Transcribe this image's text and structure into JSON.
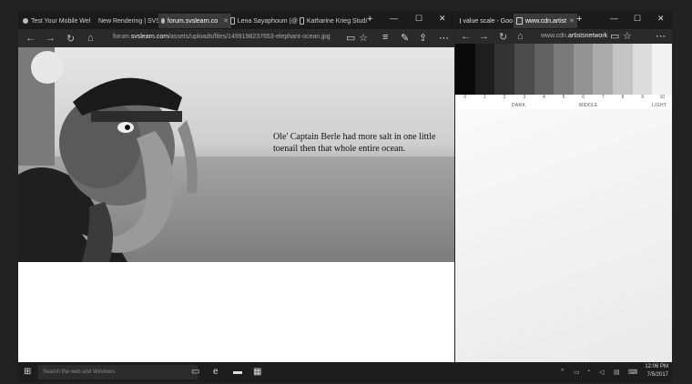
{
  "left_window": {
    "tabs": [
      {
        "label": "Test Your Mobile Wel",
        "active": false
      },
      {
        "label": "New Rendering | SVS",
        "active": false
      },
      {
        "label": "forum.svslearn.co",
        "active": true
      },
      {
        "label": "Lena Sayaphoum (@",
        "active": false
      },
      {
        "label": "Katharine Krieg Studi",
        "active": false
      }
    ],
    "new_tab": "+",
    "window_controls": {
      "minimize": "—",
      "maximize": "☐",
      "close": "✕"
    },
    "address": {
      "prefix": "forum.",
      "domain": "svslearn.com",
      "path": "/assets/uploads/files/1499198237653-elephant-ocean.jpg"
    },
    "caption": "Ole' Captain Berle had more salt in one little toenail then that whole entire ocean."
  },
  "right_window": {
    "tabs": [
      {
        "label": "value scale - Goo",
        "active": false
      },
      {
        "label": "www.cdn.artist",
        "active": true
      }
    ],
    "address": {
      "prefix": "www.cdn.",
      "domain": "artistsnetwork"
    },
    "value_scale": {
      "numbers": [
        "0",
        "1",
        "2",
        "3",
        "4",
        "5",
        "6",
        "7",
        "8",
        "9",
        "10"
      ],
      "labels": {
        "dark": "DARK",
        "middle": "MIDDLE",
        "light": "LIGHT"
      },
      "swatch_colors": [
        "#0a0a0a",
        "#1e1e1e",
        "#333333",
        "#4b4b4b",
        "#626262",
        "#7a7a7a",
        "#939393",
        "#ababab",
        "#c4c4c4",
        "#dcdcdc",
        "#f2f2f2"
      ]
    }
  },
  "taskbar": {
    "search_placeholder": "Search the web and Windows",
    "time": "12:06 PM",
    "date": "7/5/2017"
  }
}
